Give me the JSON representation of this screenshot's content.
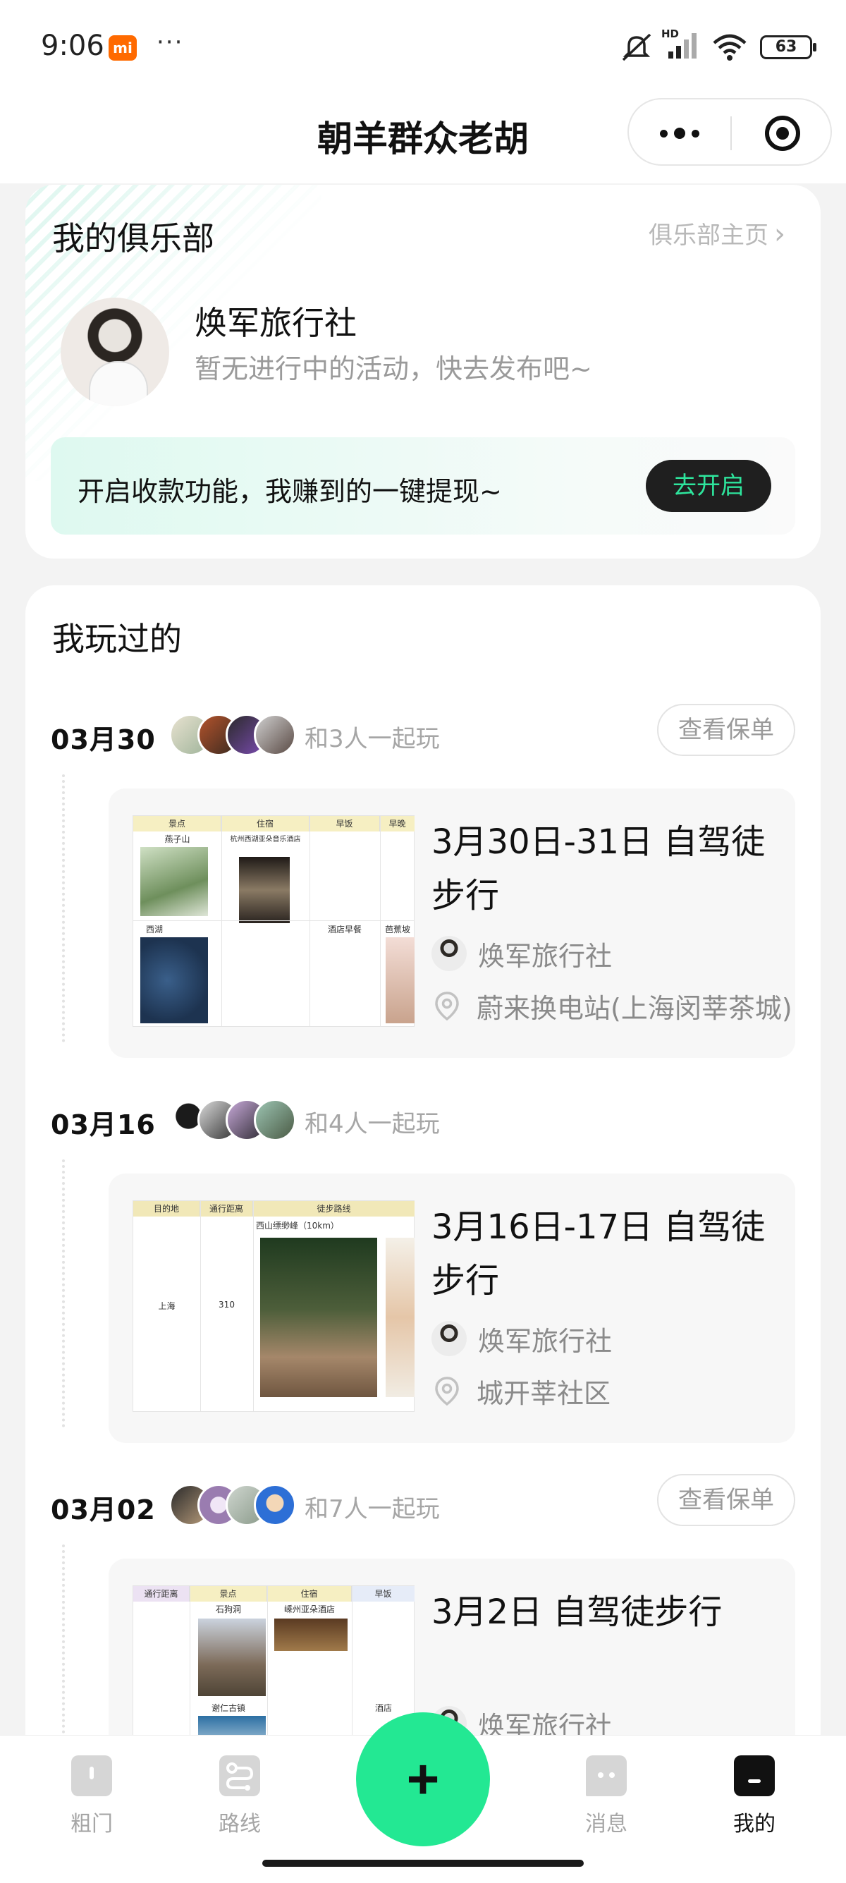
{
  "status_bar": {
    "time": "9:06",
    "battery": "63",
    "network": "HD"
  },
  "header": {
    "title": "朝羊群众老胡"
  },
  "club_card": {
    "section_title": "我的俱乐部",
    "home_link": "俱乐部主页",
    "club_name": "焕军旅行社",
    "club_status": "暂无进行中的活动，快去发布吧~",
    "promo_text": "开启收款功能，我赚到的一键提现~",
    "promo_button": "去开启"
  },
  "played_card": {
    "section_title": "我玩过的",
    "entries": [
      {
        "date": "03月30",
        "with_text": "和3人一起玩",
        "policy_button": "查看保单",
        "title": "3月30日-31日 自驾徒步行",
        "club": "焕军旅行社",
        "location": "蔚来换电站(上海闵莘茶城)",
        "thumb": {
          "h1": "景点",
          "h2": "住宿",
          "h3": "早饭",
          "h4": "早晚",
          "r1": "燕子山",
          "r1b": "杭州西湖亚朵音乐酒店",
          "r2": "西湖",
          "r2b": "酒店早餐",
          "r2c": "芭蕉坡"
        }
      },
      {
        "date": "03月16",
        "with_text": "和4人一起玩",
        "policy_button": "",
        "title": "3月16日-17日 自驾徒步行",
        "club": "焕军旅行社",
        "location": "城开莘社区",
        "thumb": {
          "h1": "目的地",
          "h2": "通行距离",
          "h3": "徒步路线",
          "c1": "上海",
          "c2": "310",
          "c3": "西山缥缈峰（10km）"
        }
      },
      {
        "date": "03月02",
        "with_text": "和7人一起玩",
        "policy_button": "查看保单",
        "title": "3月2日 自驾徒步行",
        "club": "焕军旅行社",
        "location": "",
        "thumb": {
          "h1": "通行距离",
          "h2": "景点",
          "h3": "住宿",
          "h4": "早饭",
          "c1": "石狗洞",
          "c2": "嵊州亚朵酒店",
          "c3": "谢仁古镇",
          "c4": "酒店"
        }
      }
    ]
  },
  "tab_bar": {
    "tabs": [
      {
        "label": "粗门"
      },
      {
        "label": "路线"
      },
      {
        "label": "消息"
      },
      {
        "label": "我的"
      }
    ],
    "fab": "+"
  },
  "colors": {
    "accent": "#23e893",
    "promo_button_text": "#2ee59d",
    "text_muted": "#9a9a9a"
  }
}
